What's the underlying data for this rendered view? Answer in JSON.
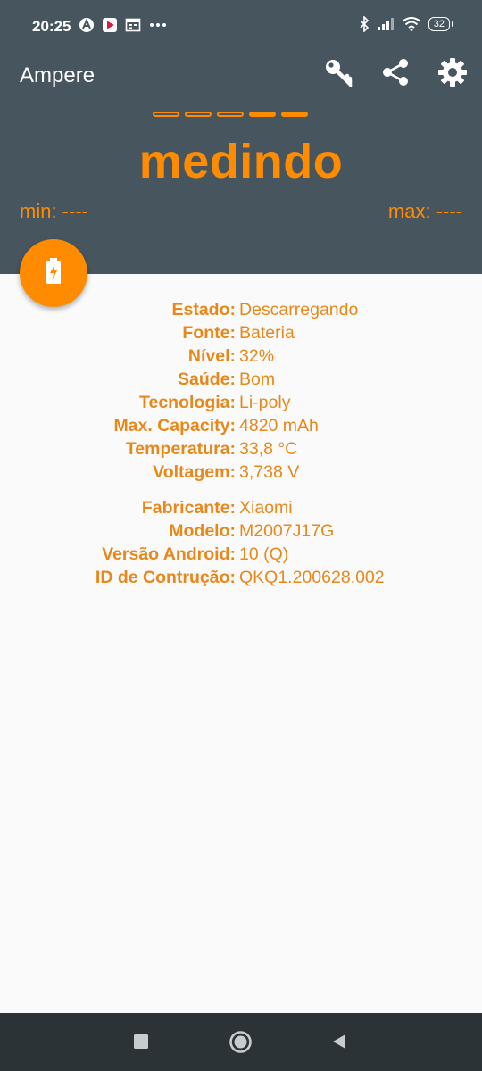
{
  "status_bar": {
    "time": "20:25",
    "left_icons": [
      "acer-notification-icon",
      "video-player-icon",
      "calendar-icon",
      "more-dots-icon"
    ],
    "right_icons": [
      "bluetooth-icon",
      "signal-icon",
      "wifi-icon"
    ],
    "battery_level": "32"
  },
  "app_bar": {
    "title": "Ampere",
    "actions": [
      "key-icon",
      "share-icon",
      "settings-icon"
    ]
  },
  "progress_dots": {
    "total": 5,
    "filled": 2
  },
  "measure": {
    "status": "medindo",
    "min_label": "min: ----",
    "max_label": "max: ----"
  },
  "battery_info": [
    {
      "key": "Estado:",
      "value": "Descarregando"
    },
    {
      "key": "Fonte:",
      "value": "Bateria"
    },
    {
      "key": "Nível:",
      "value": "32%"
    },
    {
      "key": "Saúde:",
      "value": "Bom"
    },
    {
      "key": "Tecnologia:",
      "value": "Li-poly"
    },
    {
      "key": "Max. Capacity:",
      "value": "4820 mAh"
    },
    {
      "key": "Temperatura:",
      "value": "33,8 °C"
    },
    {
      "key": "Voltagem:",
      "value": "3,738 V"
    }
  ],
  "device_info": [
    {
      "key": "Fabricante:",
      "value": "Xiaomi"
    },
    {
      "key": "Modelo:",
      "value": "M2007J17G"
    },
    {
      "key": "Versão Android:",
      "value": "10 (Q)"
    },
    {
      "key": "ID de Contrução:",
      "value": "QKQ1.200628.002"
    }
  ],
  "colors": {
    "accent": "#ff8c00",
    "header": "#47555f",
    "text": "#e8881a",
    "nav": "#2b3337"
  }
}
